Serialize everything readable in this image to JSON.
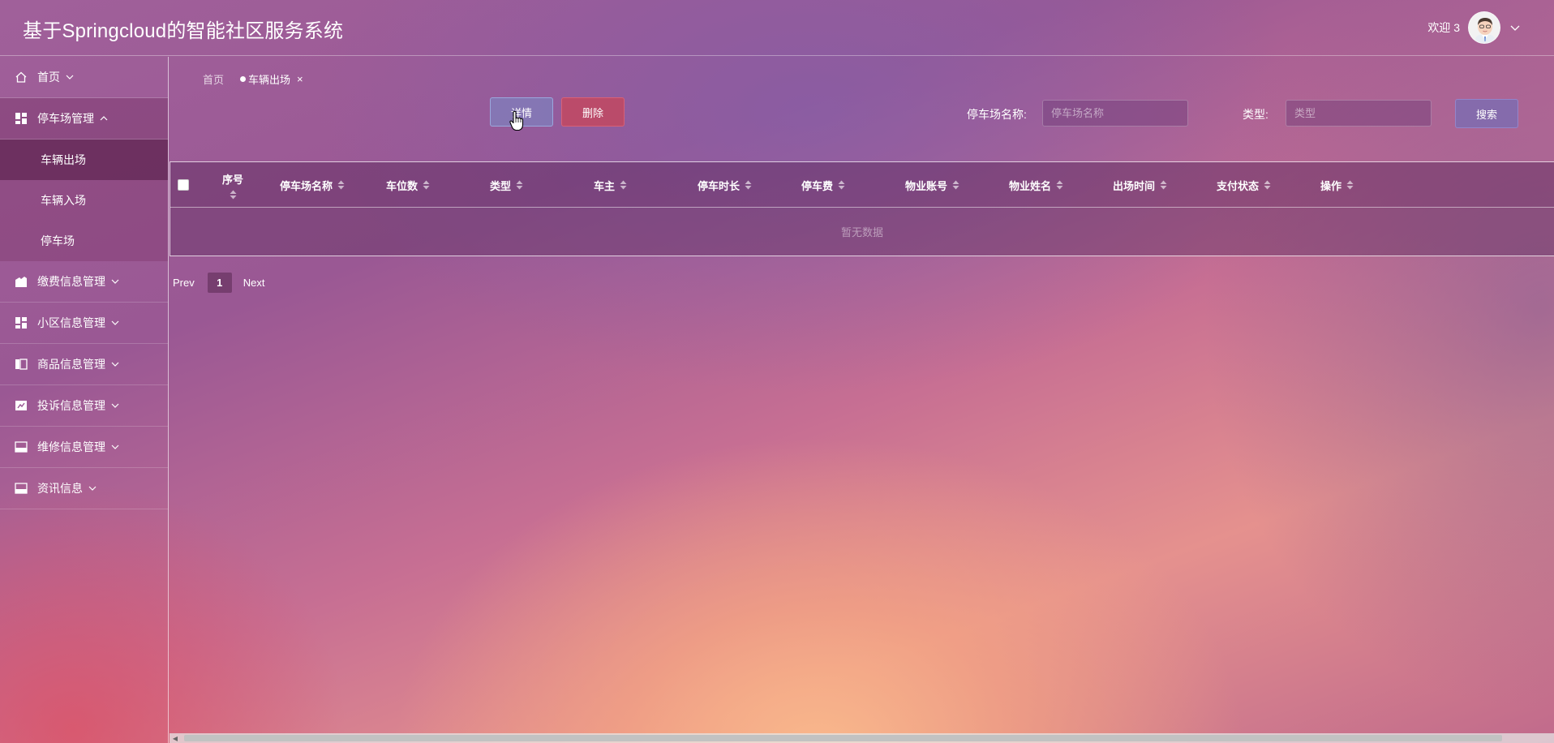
{
  "header": {
    "title": "基于Springcloud的智能社区服务系统",
    "welcome": "欢迎 3"
  },
  "sidebar": {
    "items": [
      {
        "label": "首页",
        "icon": "home-icon"
      },
      {
        "label": "停车场管理",
        "icon": "dashboard-icon",
        "expanded": true,
        "children": [
          {
            "label": "车辆出场",
            "active": true
          },
          {
            "label": "车辆入场"
          },
          {
            "label": "停车场"
          }
        ]
      },
      {
        "label": "缴费信息管理",
        "icon": "document-icon"
      },
      {
        "label": "小区信息管理",
        "icon": "dashboard-icon"
      },
      {
        "label": "商品信息管理",
        "icon": "columns-icon"
      },
      {
        "label": "投诉信息管理",
        "icon": "chart-box-icon"
      },
      {
        "label": "维修信息管理",
        "icon": "window-icon"
      },
      {
        "label": "资讯信息",
        "icon": "window-icon"
      }
    ]
  },
  "breadcrumb": {
    "home": "首页",
    "current": "车辆出场",
    "close": "×"
  },
  "toolbar": {
    "detail_label": "详情",
    "delete_label": "删除"
  },
  "search": {
    "parking_name_label": "停车场名称:",
    "parking_name_placeholder": "停车场名称",
    "type_label": "类型:",
    "type_placeholder": "类型",
    "search_label": "搜索"
  },
  "table": {
    "columns": [
      "序号",
      "停车场名称",
      "车位数",
      "类型",
      "车主",
      "停车时长",
      "停车费",
      "物业账号",
      "物业姓名",
      "出场时间",
      "支付状态",
      "操作"
    ],
    "rows": [],
    "empty_text": "暂无数据"
  },
  "pagination": {
    "prev": "Prev",
    "current_page": "1",
    "next": "Next"
  },
  "colors": {
    "delete_button": "#c8465a",
    "detail_button": "#788cc8",
    "search_button": "#786eb4"
  }
}
